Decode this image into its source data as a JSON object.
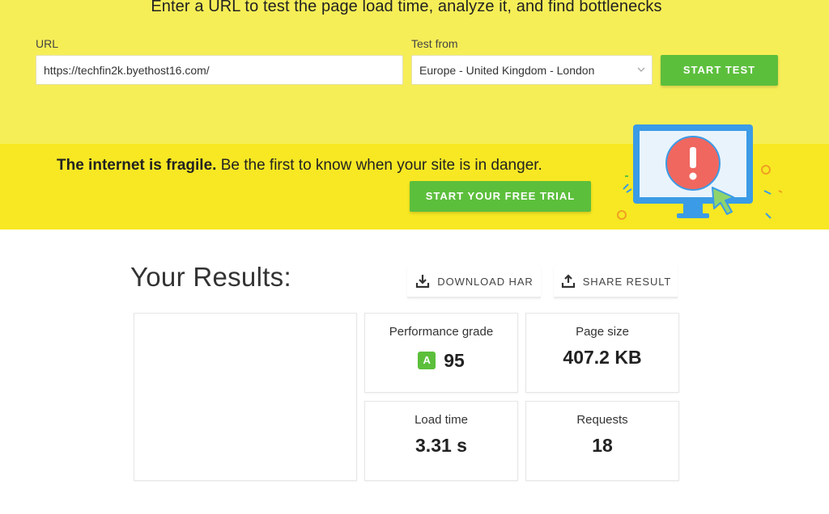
{
  "hero": {
    "headline": "Enter a URL to test the page load time, analyze it, and find bottlenecks",
    "url_label": "URL",
    "url_value": "https://techfin2k.byethost16.com/",
    "test_from_label": "Test from",
    "test_from_value": "Europe - United Kingdom - London",
    "start_test_label": "START TEST"
  },
  "promo": {
    "bold_text": "The internet is fragile.",
    "text": " Be the first to know when your site is in danger.",
    "cta_label": "START YOUR FREE TRIAL",
    "illustration_icon": "monitor-alert-icon"
  },
  "results": {
    "title": "Your Results:",
    "download_har_label": "DOWNLOAD HAR",
    "share_result_label": "SHARE RESULT",
    "metrics": {
      "performance_grade": {
        "label": "Performance grade",
        "grade": "A",
        "value": "95"
      },
      "page_size": {
        "label": "Page size",
        "value": "407.2 KB"
      },
      "load_time": {
        "label": "Load time",
        "value": "3.31 s"
      },
      "requests": {
        "label": "Requests",
        "value": "18"
      }
    }
  },
  "colors": {
    "hero_bg": "#f6ee57",
    "promo_bg": "#f7e823",
    "accent_green": "#5cbf3c",
    "alert_red": "#f0675f",
    "monitor_blue": "#3b9be6"
  }
}
